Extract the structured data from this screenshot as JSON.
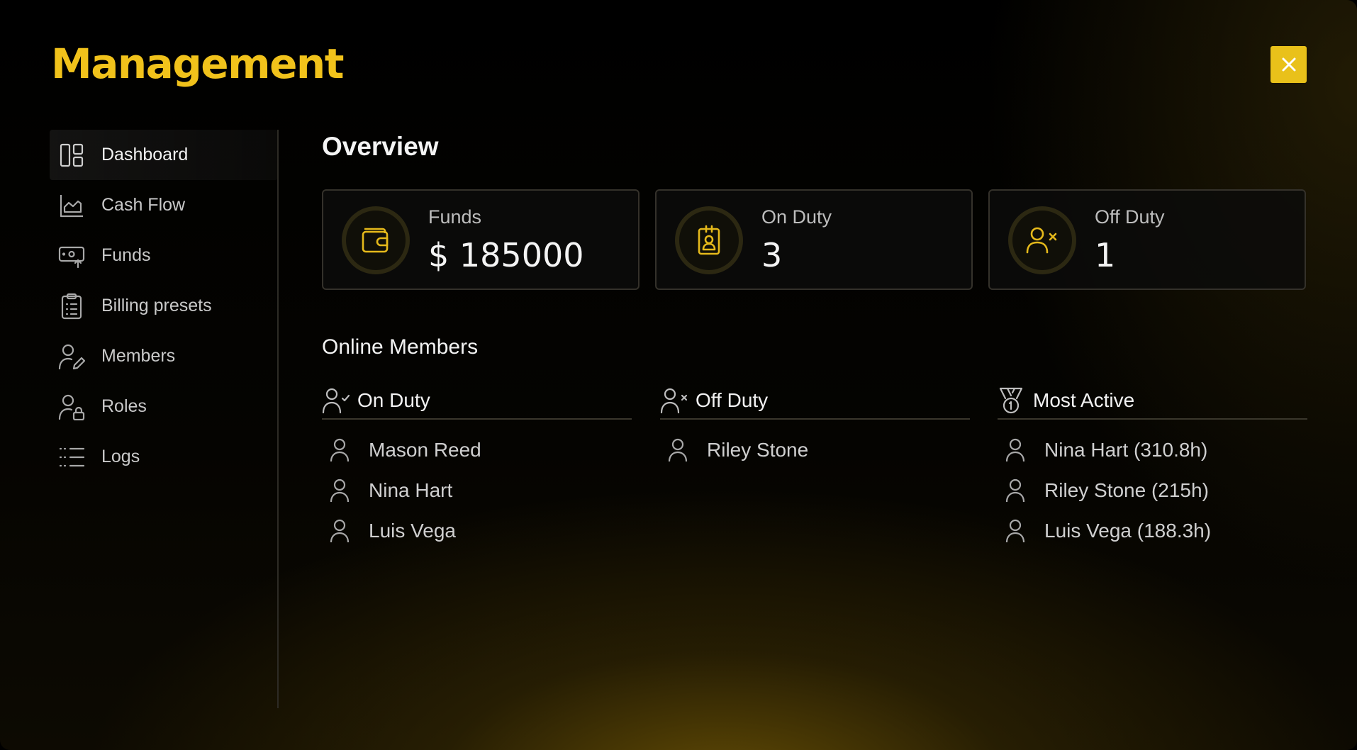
{
  "app": {
    "title": "Management",
    "accent": "#f1c21b"
  },
  "close": {
    "icon": "close-icon"
  },
  "sidebar": {
    "items": [
      {
        "label": "Dashboard",
        "icon": "dashboard-icon",
        "active": true
      },
      {
        "label": "Cash Flow",
        "icon": "chart-icon"
      },
      {
        "label": "Funds",
        "icon": "money-transfer-icon"
      },
      {
        "label": "Billing presets",
        "icon": "clipboard-list-icon"
      },
      {
        "label": "Members",
        "icon": "user-edit-icon"
      },
      {
        "label": "Roles",
        "icon": "user-lock-icon"
      },
      {
        "label": "Logs",
        "icon": "list-icon"
      }
    ]
  },
  "overview": {
    "title": "Overview",
    "cards": [
      {
        "label": "Funds",
        "value": "$ 185000",
        "icon": "wallet-icon"
      },
      {
        "label": "On Duty",
        "value": "3",
        "icon": "id-badge-icon"
      },
      {
        "label": "Off Duty",
        "value": "1",
        "icon": "user-x-icon"
      }
    ]
  },
  "online": {
    "title": "Online Members",
    "columns": [
      {
        "title": "On Duty",
        "icon": "user-check-icon",
        "members": [
          "Mason Reed",
          "Nina Hart",
          "Luis Vega"
        ]
      },
      {
        "title": "Off Duty",
        "icon": "user-x-icon",
        "members": [
          "Riley Stone"
        ]
      },
      {
        "title": "Most Active",
        "icon": "medal-icon",
        "members": [
          "Nina Hart (310.8h)",
          "Riley Stone (215h)",
          "Luis Vega (188.3h)"
        ]
      }
    ]
  }
}
